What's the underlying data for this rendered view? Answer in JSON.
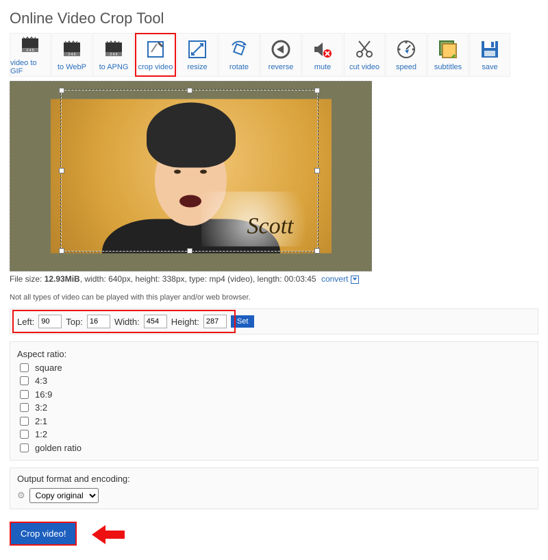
{
  "title": "Online Video Crop Tool",
  "toolbar": [
    {
      "key": "video-to-gif",
      "label": "video to GIF",
      "active": false
    },
    {
      "key": "to-webp",
      "label": "to WebP",
      "active": false
    },
    {
      "key": "to-apng",
      "label": "to APNG",
      "active": false
    },
    {
      "key": "crop-video",
      "label": "crop video",
      "active": true
    },
    {
      "key": "resize",
      "label": "resize",
      "active": false
    },
    {
      "key": "rotate",
      "label": "rotate",
      "active": false
    },
    {
      "key": "reverse",
      "label": "reverse",
      "active": false
    },
    {
      "key": "mute",
      "label": "mute",
      "active": false
    },
    {
      "key": "cut-video",
      "label": "cut video",
      "active": false
    },
    {
      "key": "speed",
      "label": "speed",
      "active": false
    },
    {
      "key": "subtitles",
      "label": "subtitles",
      "active": false
    },
    {
      "key": "save",
      "label": "save",
      "active": false
    }
  ],
  "watermark": "Scott",
  "file_info": {
    "prefix": "File size: ",
    "size": "12.93MiB",
    "rest": ", width: 640px, height: 338px, type: mp4 (video), length: 00:03:45",
    "convert_label": "convert"
  },
  "note": "Not all types of video can be played with this player and/or web browser.",
  "coords": {
    "left_label": "Left:",
    "left": "90",
    "top_label": "Top:",
    "top": "16",
    "width_label": "Width:",
    "width": "454",
    "height_label": "Height:",
    "height": "287",
    "set_label": "Set"
  },
  "ratio_header": "Aspect ratio:",
  "ratios": [
    "square",
    "4:3",
    "16:9",
    "3:2",
    "2:1",
    "1:2",
    "golden ratio"
  ],
  "output_header": "Output format and encoding:",
  "output_select": "Copy original",
  "crop_button": "Crop video!"
}
